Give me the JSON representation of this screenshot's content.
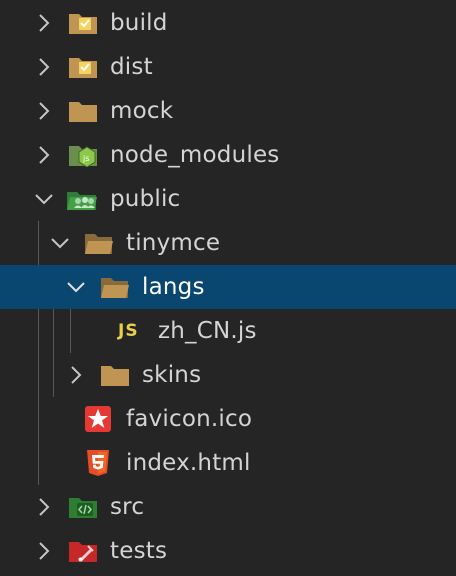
{
  "explorer": {
    "items": [
      {
        "label": "build",
        "icon": "folder-build-icon",
        "expanded": false
      },
      {
        "label": "dist",
        "icon": "folder-dist-icon",
        "expanded": false
      },
      {
        "label": "mock",
        "icon": "folder-icon",
        "expanded": false
      },
      {
        "label": "node_modules",
        "icon": "folder-node-icon",
        "expanded": false
      },
      {
        "label": "public",
        "icon": "folder-public-icon",
        "expanded": true
      },
      {
        "label": "tinymce",
        "icon": "folder-open-icon",
        "expanded": true
      },
      {
        "label": "langs",
        "icon": "folder-open-icon",
        "expanded": true,
        "selected": true
      },
      {
        "label": "zh_CN.js",
        "icon": "js-file-icon",
        "badge": "JS"
      },
      {
        "label": "skins",
        "icon": "folder-icon",
        "expanded": false
      },
      {
        "label": "favicon.ico",
        "icon": "favicon-file-icon"
      },
      {
        "label": "index.html",
        "icon": "html5-file-icon"
      },
      {
        "label": "src",
        "icon": "folder-src-icon",
        "expanded": false
      },
      {
        "label": "tests",
        "icon": "folder-test-icon",
        "expanded": false
      }
    ]
  },
  "colors": {
    "background": "#252526",
    "selection": "#094771",
    "folder": "#c09553",
    "js_badge": "#e8d04a"
  }
}
